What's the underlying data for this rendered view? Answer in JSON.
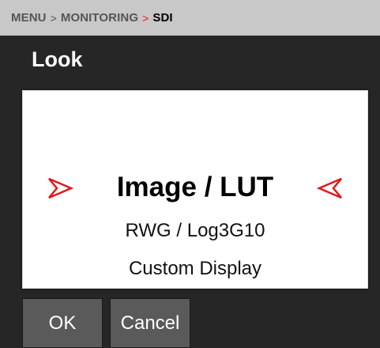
{
  "breadcrumb": {
    "items": [
      "MENU",
      "MONITORING",
      "SDI"
    ],
    "separator": ">"
  },
  "page": {
    "title": "Look"
  },
  "selector": {
    "value": "Image / LUT",
    "subtitle": "RWG / Log3G10",
    "description": "Custom Display",
    "prev_icon": "chevron-left-red",
    "next_icon": "chevron-right-red"
  },
  "buttons": {
    "ok": "OK",
    "cancel": "Cancel"
  },
  "colors": {
    "accent": "#e01a1a",
    "background": "#262626",
    "breadcrumb_bg": "#c8c8c8",
    "button_bg": "#5a5a5a"
  }
}
